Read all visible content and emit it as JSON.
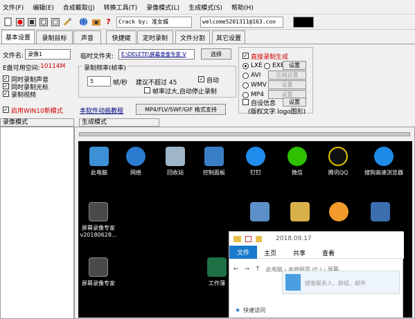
{
  "menubar": [
    "文件(F)",
    "编辑(E)",
    "合成截取(J)",
    "转换工具(T)",
    "录像模式(L)",
    "生成模式(S)",
    "帮助(H)"
  ],
  "toolbar": {
    "crack_text": "Crack by: 准女婿",
    "welcome_text": "welcome5201311@163.con",
    "icons": [
      "new-icon",
      "record-icon",
      "stop-icon",
      "pause-icon",
      "save-icon",
      "tool-icon",
      "globe-icon",
      "camera-icon",
      "help-icon"
    ]
  },
  "tabs": [
    "基本设置",
    "录制目标",
    "声音",
    "快捷键",
    "定时录制",
    "文件分割",
    "其它设置"
  ],
  "basic": {
    "filename_label": "文件名:",
    "filename_value": "录像1",
    "disk_space_label": "E盘可用空间:",
    "disk_space_value": "10114M",
    "temp_folder_label": "临时文件夹:",
    "temp_folder_value": "E:\\DELETE\\屏幕录像专家 V",
    "browse_button": "选择",
    "chk_audio": "同时录制声音",
    "chk_cursor": "同时录制光标",
    "chk_video": "录制视频",
    "chk_win10": "启用WIN10新模式",
    "fps_group_title": "录制频率(帧率)",
    "fps_value": "5",
    "fps_unit": "帧/秒",
    "fps_hint": "建议不超过 45",
    "auto_label": "自动",
    "drop_label": "帧率过大,自动停止录制",
    "tutorial_link": "本软件动画教程",
    "formats_button": "MP4/FLV/SWF/GIF  格式支持"
  },
  "generate": {
    "direct_label": "直接录制生成",
    "options": [
      {
        "left": "LXE",
        "right": "EXE",
        "button": "设置",
        "enabled": true
      },
      {
        "left": "AVI",
        "right": "",
        "button": "压缩设置",
        "enabled": false
      },
      {
        "left": "WMV",
        "right": "",
        "button": "设置",
        "enabled": false
      },
      {
        "left": "MP4",
        "right": "",
        "button": "设置",
        "enabled": false
      }
    ],
    "custom_info_label": "自设信息",
    "custom_info_button": "设置",
    "custom_info_desc": "(版权文字 logo图形)"
  },
  "status": {
    "record_mode": "录像模式",
    "generate_mode": "生成模式"
  },
  "desktop": {
    "icons": [
      {
        "label": "此电脑",
        "color": "#3d8fd6"
      },
      {
        "label": "网络",
        "color": "#2b7bd0"
      },
      {
        "label": "回收站",
        "color": "#9fb6c8"
      },
      {
        "label": "控制面板",
        "color": "#3a7fc5"
      },
      {
        "label": "钉钉",
        "color": "#1f8cec"
      },
      {
        "label": "微信",
        "color": "#2dc100"
      },
      {
        "label": "腾讯QQ",
        "color": "#111111"
      },
      {
        "label": "搜狗高速浏览器",
        "color": "#1e8be6"
      }
    ],
    "second_row": [
      {
        "label": "屏幕录像专家 v20180628...",
        "color": "#4a4a4a"
      },
      {
        "label": "",
        "color": "#5b8fc7"
      },
      {
        "label": "",
        "color": "#d8b04a"
      },
      {
        "label": "",
        "color": "#f29b2c"
      },
      {
        "label": "",
        "color": "#3b6fb0"
      }
    ],
    "third_row": [
      {
        "label": "屏幕录像专家",
        "color": "#4a4a4a"
      },
      {
        "label": "工作薄",
        "color": "#1e7145"
      }
    ]
  },
  "explorer": {
    "title": "2018.09.17",
    "ribbon_tabs": [
      "文件",
      "主页",
      "共享",
      "查看"
    ],
    "search_placeholder": "搜索联系人、群组、邮件",
    "nav_text": "此电脑 › 本地磁盘 (E:) › 屏幕",
    "quick_access": "快速访问"
  }
}
